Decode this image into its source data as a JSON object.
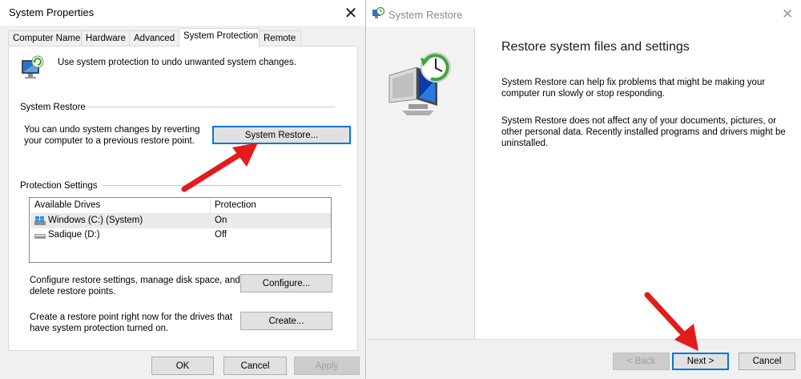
{
  "sysprops": {
    "title": "System Properties",
    "close": "✕",
    "tabs": [
      "Computer Name",
      "Hardware",
      "Advanced",
      "System Protection",
      "Remote"
    ],
    "intro": "Use system protection to undo unwanted system changes.",
    "restore_group": "System Restore",
    "restore_text_1": "You can undo system changes by reverting",
    "restore_text_2": "your computer to a previous restore point.",
    "restore_button": "System Restore...",
    "protection_group": "Protection Settings",
    "columns": [
      "Available Drives",
      "Protection"
    ],
    "drives": [
      {
        "name": "Windows (C:) (System)",
        "protection": "On"
      },
      {
        "name": "Sadique (D:)",
        "protection": "Off"
      }
    ],
    "configure_text_1": "Configure restore settings, manage disk space, and",
    "configure_text_2": "delete restore points.",
    "configure_button": "Configure...",
    "create_text_1": "Create a restore point right now for the drives that",
    "create_text_2": "have system protection turned on.",
    "create_button": "Create...",
    "ok": "OK",
    "cancel": "Cancel",
    "apply": "Apply"
  },
  "restore": {
    "title": "System Restore",
    "close": "✕",
    "heading": "Restore system files and settings",
    "para1_1": "System Restore can help fix problems that might be making your",
    "para1_2": "computer run slowly or stop responding.",
    "para2_1": "System Restore does not affect any of your documents, pictures, or",
    "para2_2": "other personal data. Recently installed programs and drivers might be",
    "para2_3": "uninstalled.",
    "back": "< Back",
    "next": "Next >",
    "cancel": "Cancel"
  },
  "colors": {
    "accent": "#0078d7",
    "arrow": "#e31b1b"
  }
}
